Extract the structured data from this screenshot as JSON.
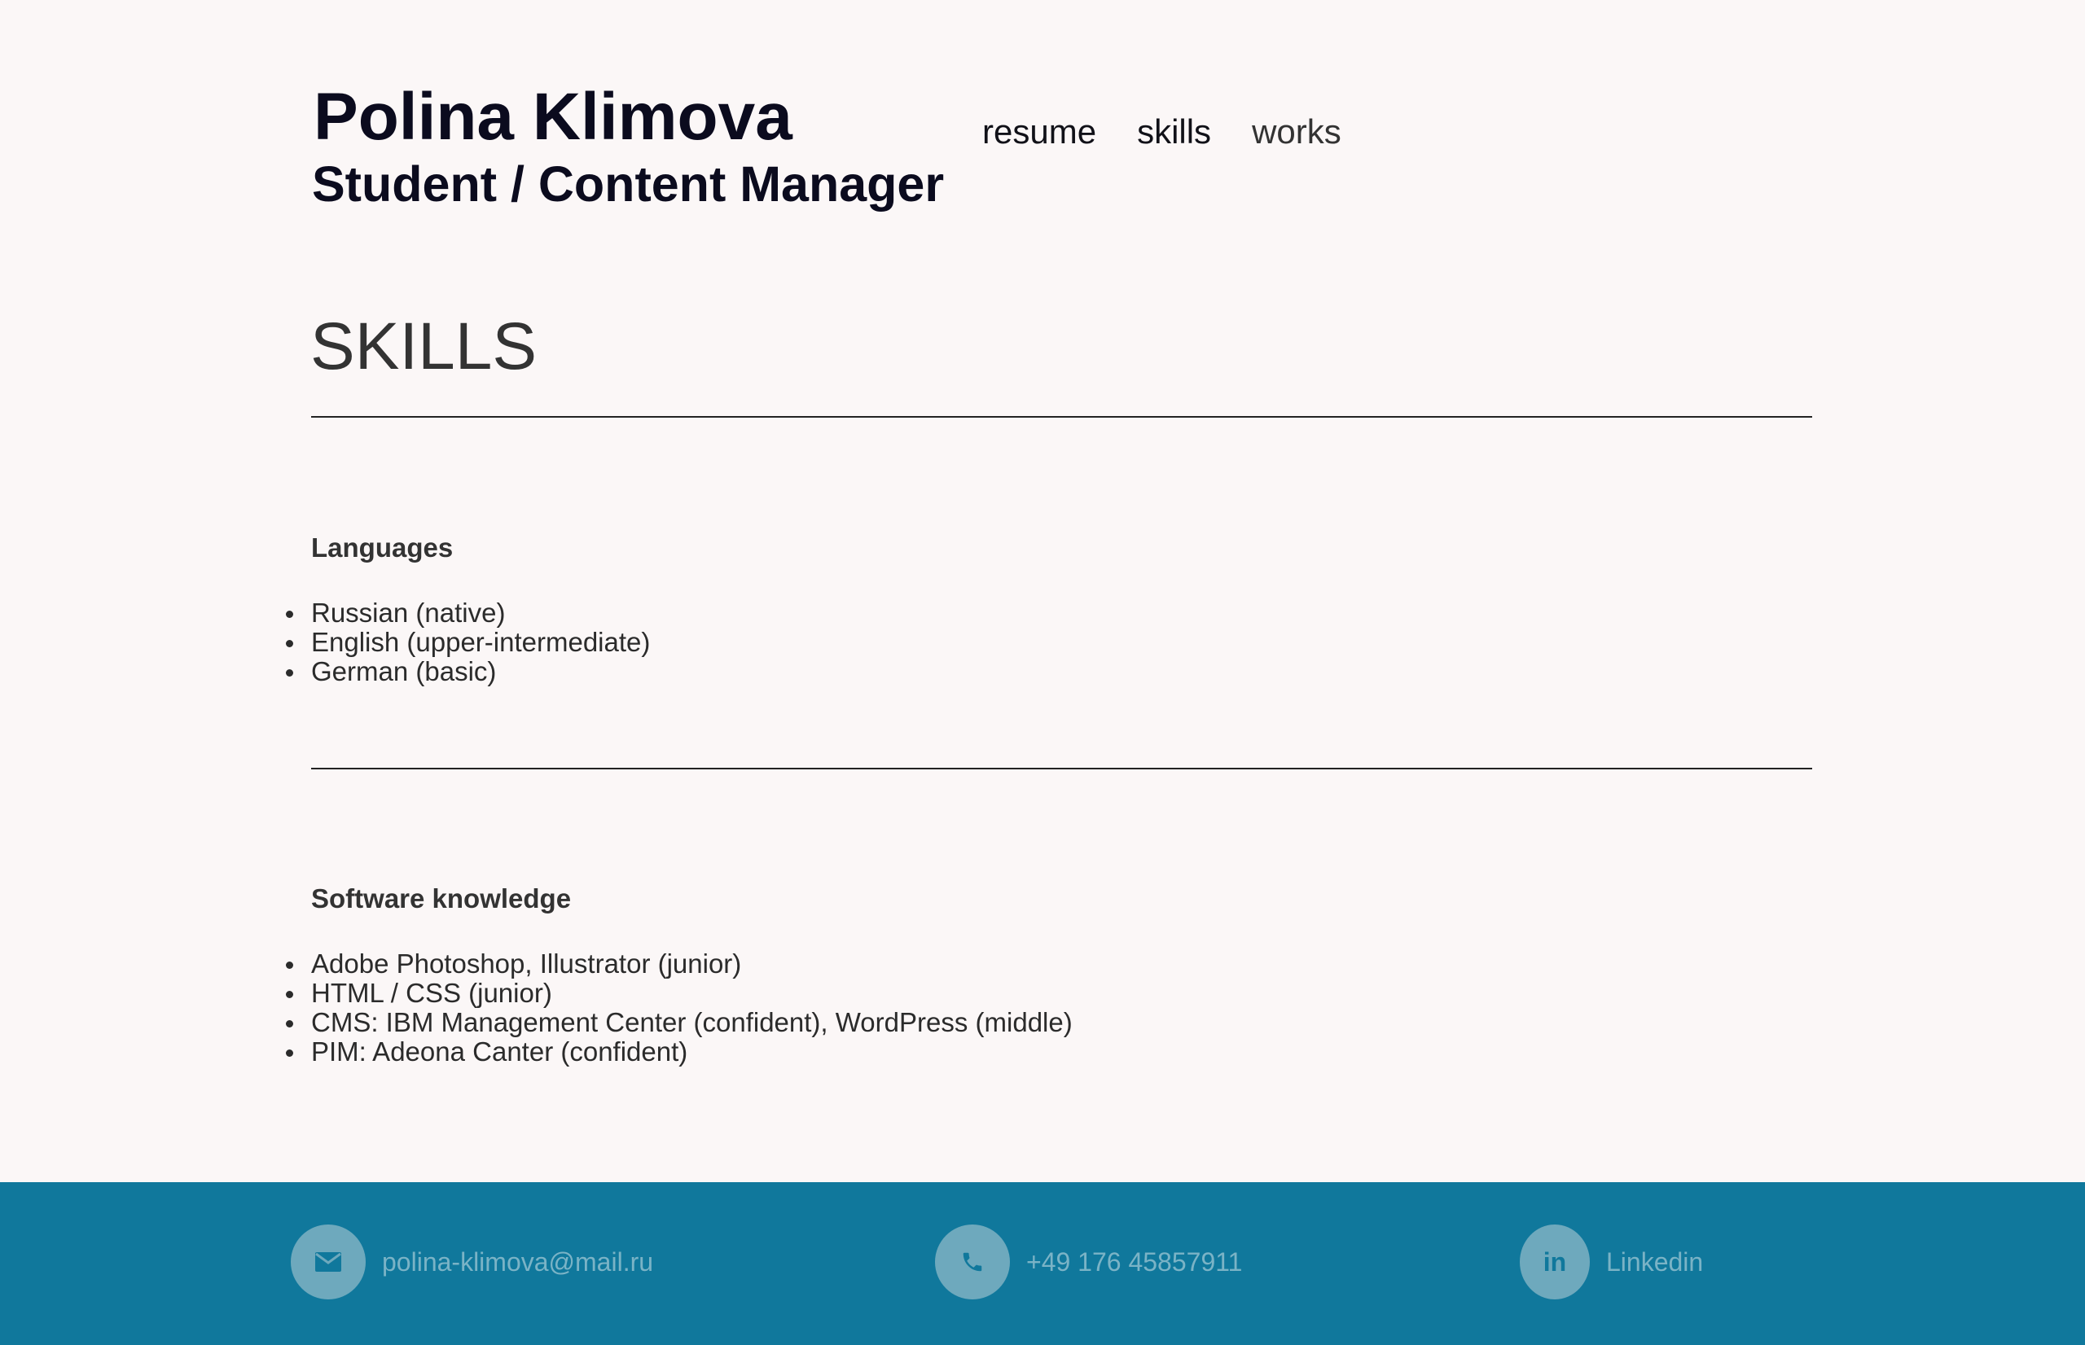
{
  "header": {
    "name": "Polina Klimova",
    "role": "Student / Content Manager"
  },
  "nav": {
    "items": [
      {
        "label": "resume"
      },
      {
        "label": "skills"
      },
      {
        "label": "works"
      }
    ]
  },
  "main": {
    "title": "SKILLS",
    "groups": [
      {
        "heading": "Languages",
        "items": [
          "Russian (native)",
          "English (upper-intermediate)",
          "German (basic)"
        ]
      },
      {
        "heading": "Software knowledge",
        "items": [
          "Adobe Photoshop, Illustrator (junior)",
          "HTML / CSS (junior)",
          "CMS: IBM Management Center (confident), WordPress (middle)",
          "PIM: Adeona Canter (confident)"
        ]
      }
    ]
  },
  "footer": {
    "contacts": [
      {
        "icon": "envelope-icon",
        "label": "polina-klimova@mail.ru"
      },
      {
        "icon": "phone-icon",
        "label": "+49 176 45857911"
      },
      {
        "icon": "linkedin-icon",
        "label": "Linkedin"
      }
    ]
  },
  "colors": {
    "background": "#fbf7f7",
    "footer": "#10789c",
    "icon_circle": "#6ea9bd",
    "footer_text": "#7ab3c6"
  }
}
